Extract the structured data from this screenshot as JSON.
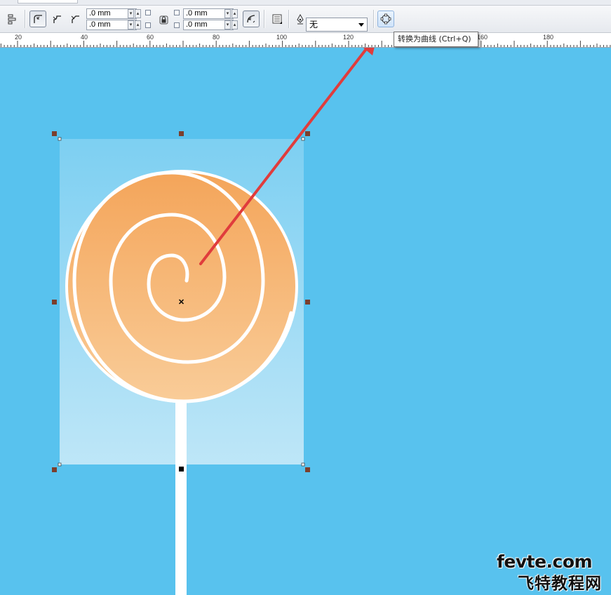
{
  "toolbar": {
    "field_1": ".0 mm",
    "field_2": ".0 mm",
    "field_3": ".0 mm",
    "field_4": ".0 mm",
    "outline_style_value": "无"
  },
  "tooltip": {
    "text": "转换为曲线 (Ctrl+Q)"
  },
  "ruler": {
    "labels": [
      "20",
      "40",
      "60",
      "80",
      "100",
      "120",
      "160",
      "180"
    ]
  },
  "watermark": {
    "line1": "fevte.com",
    "line2": "飞特教程网"
  },
  "colors": {
    "canvas_bg": "#58c2ee",
    "candy_top": "#f4a75c",
    "candy_bottom": "#f8c994",
    "arrow": "#e03c3c",
    "handle": "#7b3f2d"
  }
}
